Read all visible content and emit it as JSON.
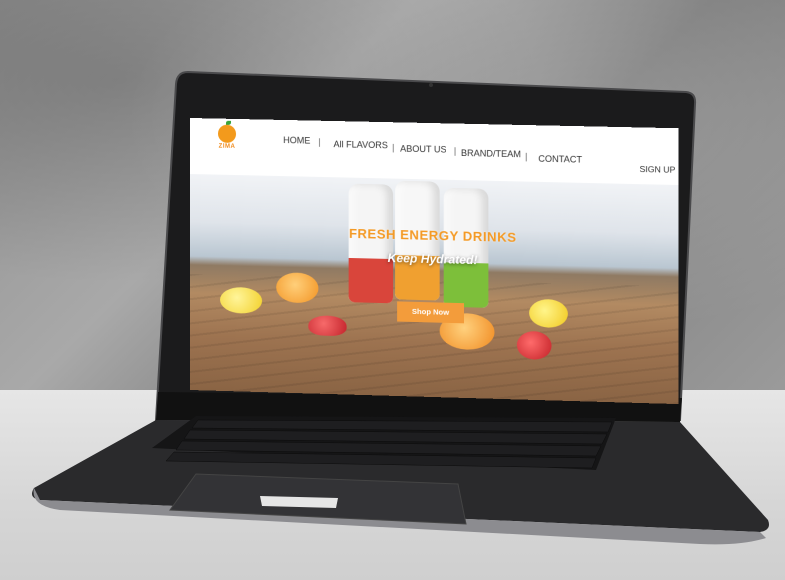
{
  "brand": {
    "logo_text": "ZIMA"
  },
  "nav": {
    "items": [
      {
        "label": "HOME"
      },
      {
        "label": "All FLAVORS"
      },
      {
        "label": "ABOUT US"
      },
      {
        "label": "BRAND/TEAM"
      },
      {
        "label": "CONTACT"
      }
    ],
    "separator": "|",
    "signup_label": "SIGN UP"
  },
  "hero": {
    "headline": "FRESH ENERGY DRINKS",
    "subline": "Keep Hydrated!",
    "shop_button": "Shop Now"
  },
  "colors": {
    "accent_orange": "#f39c3b",
    "can_red": "#d9453b",
    "can_orange": "#f0a030",
    "can_green": "#7dbf3a"
  },
  "icons": {
    "logo": "orange-logo-icon"
  }
}
